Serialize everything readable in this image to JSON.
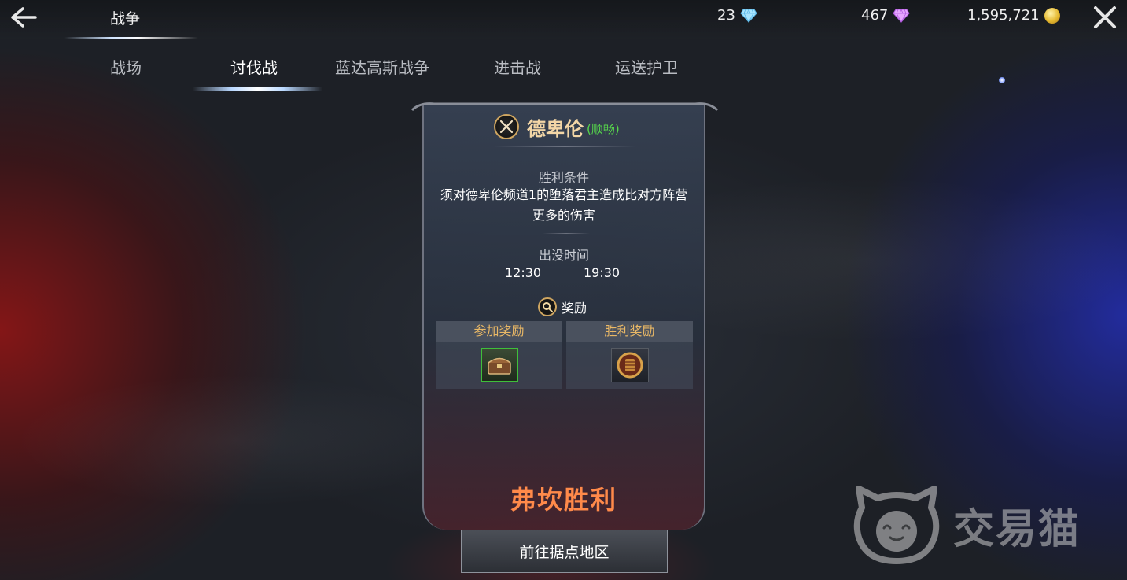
{
  "header": {
    "back_icon": "back-arrow-icon",
    "title": "战争",
    "close_icon": "close-icon"
  },
  "currencies": [
    {
      "value": "23",
      "icon": "diamond-icon",
      "color": "#8fd4ff"
    },
    {
      "value": "467",
      "icon": "purple-diamond-icon",
      "color": "#d57bff"
    },
    {
      "value": "1,595,721",
      "icon": "gold-coin-icon",
      "color": "#e5b930"
    }
  ],
  "tabs": [
    {
      "label": "战场",
      "active": false
    },
    {
      "label": "讨伐战",
      "active": true
    },
    {
      "label": "蓝达高斯战争",
      "active": false
    },
    {
      "label": "进击战",
      "active": false
    },
    {
      "label": "运送护卫",
      "active": false
    }
  ],
  "panel": {
    "title": "德卑伦",
    "status": "(顺畅)",
    "victory_condition_label": "胜利条件",
    "victory_condition_text": "须对德卑伦频道1的堕落君主造成比对方阵营更多的伤害",
    "time_label": "出没时间",
    "times": [
      "12:30",
      "19:30"
    ],
    "reward_label": "奖励",
    "rewards": [
      {
        "label": "参加奖励",
        "item": "treasure-chest-icon"
      },
      {
        "label": "胜利奖励",
        "item": "fist-emblem-icon"
      }
    ],
    "result": "弗坎胜利",
    "goto_button": "前往据点地区"
  },
  "watermark": {
    "text": "交易猫",
    "icon": "cat-logo-icon"
  },
  "colors": {
    "accent_gold": "#e9b866",
    "status_green": "#56d64b",
    "victory_orange": "#ff8a4a"
  }
}
